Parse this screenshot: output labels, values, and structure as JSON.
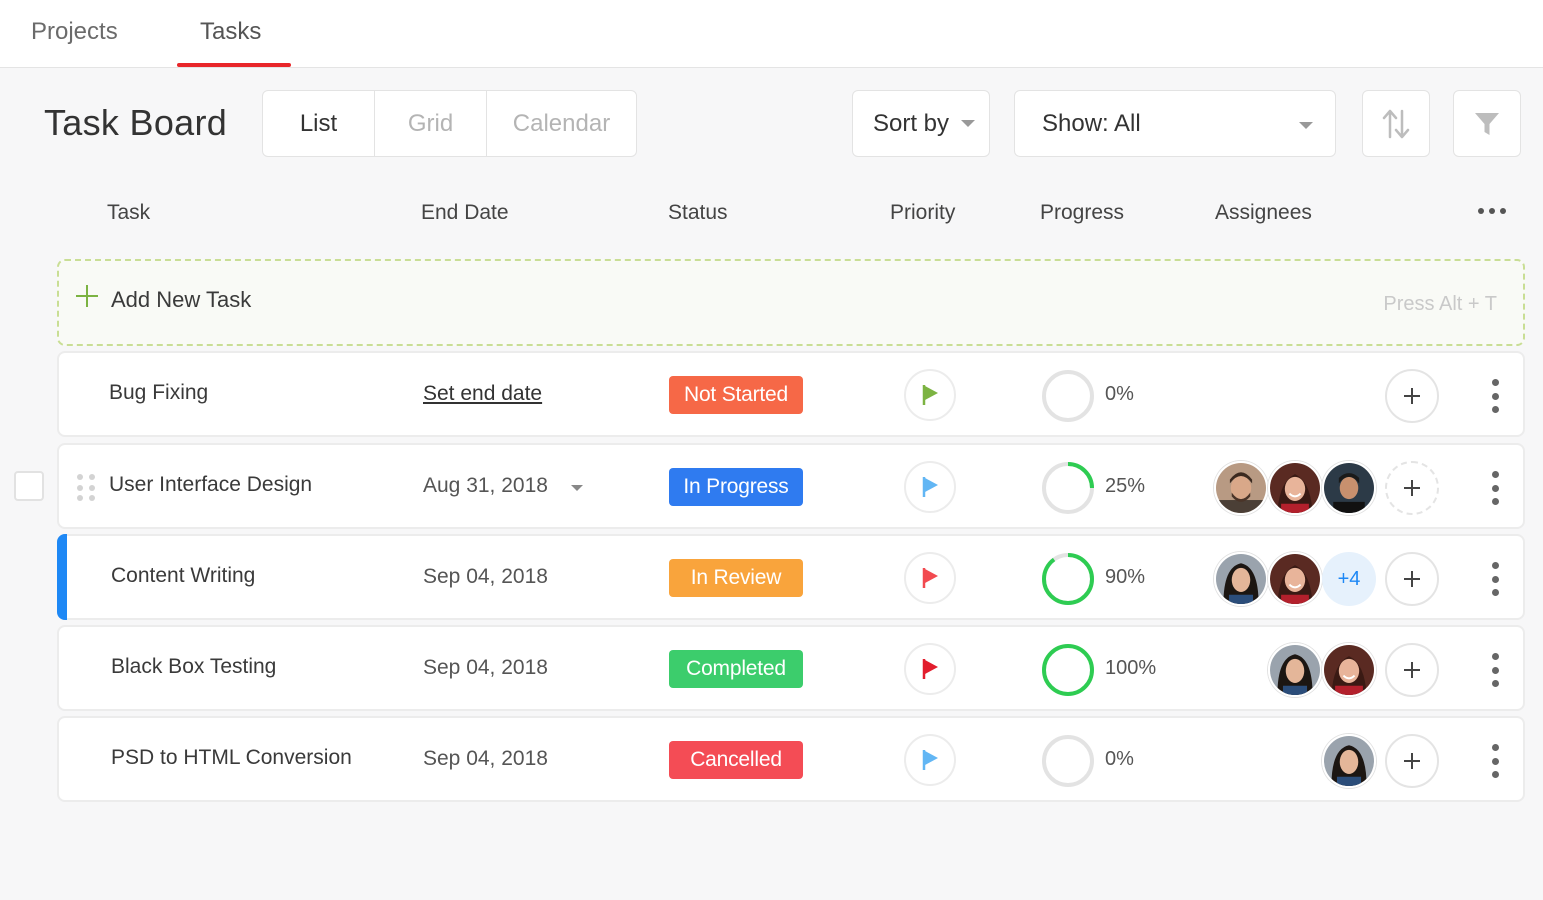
{
  "nav": {
    "tabs": [
      {
        "label": "Projects",
        "active": false
      },
      {
        "label": "Tasks",
        "active": true
      }
    ]
  },
  "board": {
    "title": "Task Board",
    "views": [
      "List",
      "Grid",
      "Calendar"
    ],
    "active_view": "List",
    "sort_label": "Sort by",
    "show_label": "Show: All",
    "sort_icon": "sort-arrows-icon",
    "filter_icon": "funnel-icon"
  },
  "columns": [
    "Task",
    "End Date",
    "Status",
    "Priority",
    "Progress",
    "Assignees"
  ],
  "add_task": {
    "label": "Add New Task",
    "hint": "Press Alt + T"
  },
  "colors": {
    "accent_red": "#e8262a",
    "accent_blue": "#1e88f5",
    "status_not_started": "#f66847",
    "status_in_progress": "#2f7bf0",
    "status_in_review": "#f9a43c",
    "status_completed": "#3ccd6c",
    "status_cancelled": "#f44c55",
    "priority_low": "#7cb342",
    "priority_normal": "#62b6f4",
    "priority_high": "#f24a50",
    "priority_urgent": "#e21d2d",
    "progress_green": "#2ecc52"
  },
  "tasks": [
    {
      "name": "Bug Fixing",
      "end_date": "Set end date",
      "status": "Not Started",
      "priority": "low",
      "progress": 0,
      "progress_label": "0%",
      "assignees": [],
      "extra_assignees": ""
    },
    {
      "name": "User Interface Design",
      "end_date": "Aug 31, 2018",
      "status": "In Progress",
      "priority": "normal",
      "progress": 25,
      "progress_label": "25%",
      "assignees": [
        "avatar-man-beard",
        "avatar-woman-smiling",
        "avatar-man-dark"
      ],
      "extra_assignees": ""
    },
    {
      "name": "Content Writing",
      "end_date": "Sep 04, 2018",
      "status": "In Review",
      "priority": "high",
      "progress": 90,
      "progress_label": "90%",
      "assignees": [
        "avatar-woman-dark-hair",
        "avatar-woman-smiling"
      ],
      "extra_assignees": "+4"
    },
    {
      "name": "Black Box Testing",
      "end_date": "Sep 04, 2018",
      "status": "Completed",
      "priority": "urgent",
      "progress": 100,
      "progress_label": "100%",
      "assignees": [
        "avatar-woman-dark-hair",
        "avatar-woman-smiling"
      ],
      "extra_assignees": ""
    },
    {
      "name": "PSD to HTML Conversion",
      "end_date": "Sep 04, 2018",
      "status": "Cancelled",
      "priority": "normal",
      "progress": 0,
      "progress_label": "0%",
      "assignees": [
        "avatar-woman-dark-hair"
      ],
      "extra_assignees": ""
    }
  ]
}
